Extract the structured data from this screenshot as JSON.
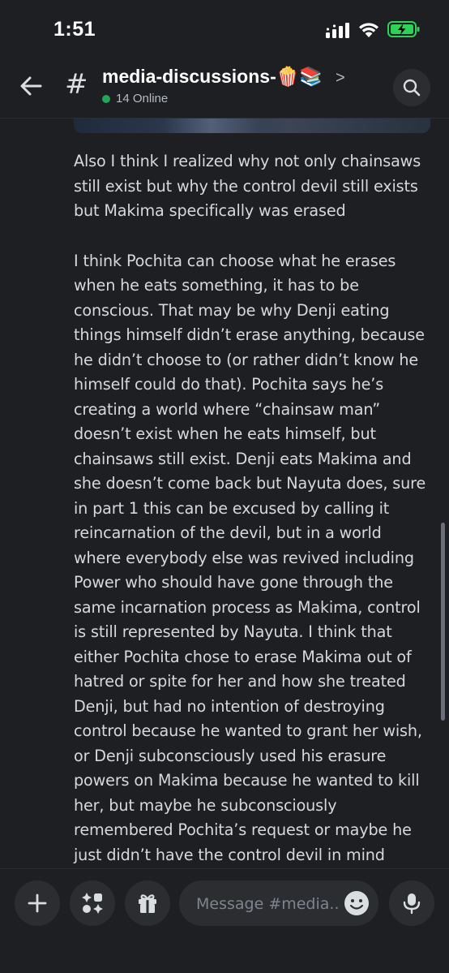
{
  "status_bar": {
    "time": "1:51",
    "battery_color": "#30d158"
  },
  "header": {
    "channel_name": "media-discussions-🍿📚",
    "online_count": "14 Online",
    "online_color": "#23a55a",
    "icons": [
      "back-arrow-icon",
      "hash-icon",
      "chevron-right-icon",
      "search-icon"
    ]
  },
  "message": {
    "paragraphs": [
      "Also I think I realized why not only chainsaws\nstill exist but why the control devil still exists\nbut Makima specifically was erased",
      "I think Pochita can choose what he erases\nwhen he eats something, it has to be\nconscious. That may be why Denji eating\nthings himself didn’t erase anything, because\nhe didn’t choose to (or rather didn’t know he\nhimself could do that). Pochita says he’s\ncreating a world where “chainsaw man”\ndoesn’t exist when he eats himself, but\nchainsaws still exist. Denji eats Makima and\nshe doesn’t come back but Nayuta does, sure\nin part 1 this can be excused by calling it\nreincarnation of the devil, but in a world\nwhere everybody else was revived including\nPower who should have gone through the\nsame incarnation process as Makima, control\nis still represented by Nayuta. I think that\neither Pochita chose to erase Makima out of\nhatred or spite for her and how she treated\nDenji, but had no intention of destroying\ncontrol because he wanted to grant her wish,\nor Denji subconsciously used his erasure\npowers on Makima because he wanted to kill\nher, but maybe he subconsciously\nremembered Pochita’s request or maybe he\njust didn’t have the control devil in mind"
    ]
  },
  "composer": {
    "placeholder": "Message #media..",
    "icons": [
      "plus-icon",
      "apps-icon",
      "gift-icon",
      "emoji-icon",
      "microphone-icon"
    ]
  }
}
